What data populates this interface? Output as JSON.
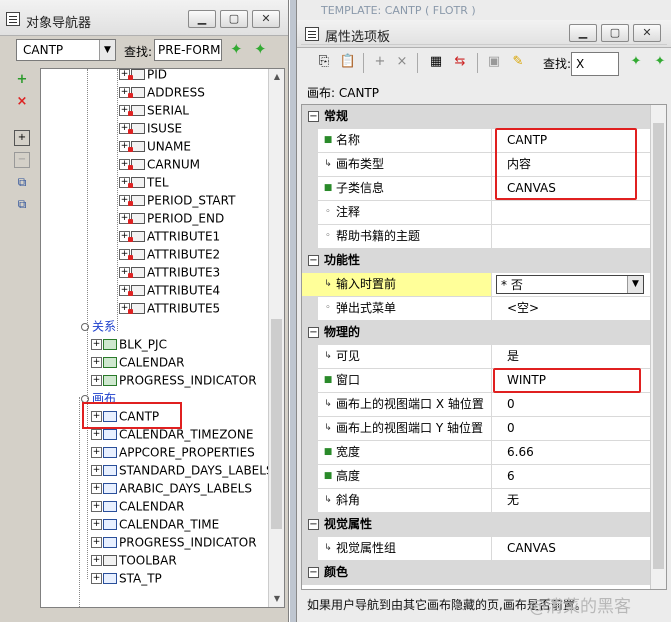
{
  "navigator": {
    "title": "对象导航器",
    "module_combo": "CANTP",
    "find_label": "查找:",
    "find_value": "PRE-FORM",
    "tree": [
      {
        "label": "PID",
        "kind": "item"
      },
      {
        "label": "ADDRESS",
        "kind": "item"
      },
      {
        "label": "SERIAL",
        "kind": "item"
      },
      {
        "label": "ISUSE",
        "kind": "item"
      },
      {
        "label": "UNAME",
        "kind": "item"
      },
      {
        "label": "CARNUM",
        "kind": "item"
      },
      {
        "label": "TEL",
        "kind": "item"
      },
      {
        "label": "PERIOD_START",
        "kind": "item"
      },
      {
        "label": "PERIOD_END",
        "kind": "item"
      },
      {
        "label": "ATTRIBUTE1",
        "kind": "item"
      },
      {
        "label": "ATTRIBUTE2",
        "kind": "item"
      },
      {
        "label": "ATTRIBUTE3",
        "kind": "item"
      },
      {
        "label": "ATTRIBUTE4",
        "kind": "item"
      },
      {
        "label": "ATTRIBUTE5",
        "kind": "item"
      },
      {
        "label": "关系",
        "kind": "folder"
      },
      {
        "label": "BLK_PJC",
        "kind": "block"
      },
      {
        "label": "CALENDAR",
        "kind": "block"
      },
      {
        "label": "PROGRESS_INDICATOR",
        "kind": "block"
      },
      {
        "label": "画布",
        "kind": "folder"
      },
      {
        "label": "CANTP",
        "kind": "canvas"
      },
      {
        "label": "CALENDAR_TIMEZONE",
        "kind": "canvas"
      },
      {
        "label": "APPCORE_PROPERTIES",
        "kind": "canvas"
      },
      {
        "label": "STANDARD_DAYS_LABELS",
        "kind": "canvas"
      },
      {
        "label": "ARABIC_DAYS_LABELS",
        "kind": "canvas"
      },
      {
        "label": "CALENDAR",
        "kind": "canvas"
      },
      {
        "label": "CALENDAR_TIME",
        "kind": "canvas"
      },
      {
        "label": "PROGRESS_INDICATOR",
        "kind": "canvas"
      },
      {
        "label": "TOOLBAR",
        "kind": "toolbar"
      },
      {
        "label": "STA_TP",
        "kind": "canvas"
      }
    ]
  },
  "palette": {
    "background_title": "TEMPLATE: CANTP ( FLOTR )",
    "title": "属性选项板",
    "find_label": "查找:",
    "find_value": "X",
    "object_label": "画布: CANTP",
    "rows": [
      {
        "type": "cat",
        "label": "常规"
      },
      {
        "type": "prop",
        "marker": "dot",
        "name": "名称",
        "value": "CANTP"
      },
      {
        "type": "prop",
        "marker": "arrow",
        "name": "画布类型",
        "value": "内容"
      },
      {
        "type": "prop",
        "marker": "dot",
        "name": "子类信息",
        "value": "CANVAS"
      },
      {
        "type": "prop",
        "marker": "small",
        "name": "注释",
        "value": ""
      },
      {
        "type": "prop",
        "marker": "small",
        "name": "帮助书籍的主题",
        "value": ""
      },
      {
        "type": "cat",
        "label": "功能性"
      },
      {
        "type": "prop",
        "marker": "arrow",
        "name": "输入时置前",
        "value": "* 否",
        "active": true
      },
      {
        "type": "prop",
        "marker": "small",
        "name": "弹出式菜单",
        "value": "<空>"
      },
      {
        "type": "cat",
        "label": "物理的"
      },
      {
        "type": "prop",
        "marker": "arrow",
        "name": "可见",
        "value": "是"
      },
      {
        "type": "prop",
        "marker": "dot",
        "name": "窗口",
        "value": "WINTP"
      },
      {
        "type": "prop",
        "marker": "arrow",
        "name": "画布上的视图端口 X 轴位置",
        "value": "0"
      },
      {
        "type": "prop",
        "marker": "arrow",
        "name": "画布上的视图端口 Y 轴位置",
        "value": "0"
      },
      {
        "type": "prop",
        "marker": "dot",
        "name": "宽度",
        "value": "6.66"
      },
      {
        "type": "prop",
        "marker": "dot",
        "name": "高度",
        "value": "6"
      },
      {
        "type": "prop",
        "marker": "arrow",
        "name": "斜角",
        "value": "无"
      },
      {
        "type": "cat",
        "label": "视觉属性"
      },
      {
        "type": "prop",
        "marker": "arrow",
        "name": "视觉属性组",
        "value": "CANVAS"
      },
      {
        "type": "cat",
        "label": "颜色"
      }
    ],
    "hint": "如果用户导航到由其它画布隐藏的页,画布是否前置。",
    "watermark": "@清菜的黑客"
  },
  "icons": {
    "add": "plus-icon",
    "delete": "x-icon",
    "expand": "expand-icon",
    "collapse": "collapse-icon",
    "flashlight": "flashlight-icon"
  },
  "colors": {
    "highlight_red": "#e02020",
    "active_row": "#ffff99",
    "folder_text": "#1c3fcc"
  }
}
